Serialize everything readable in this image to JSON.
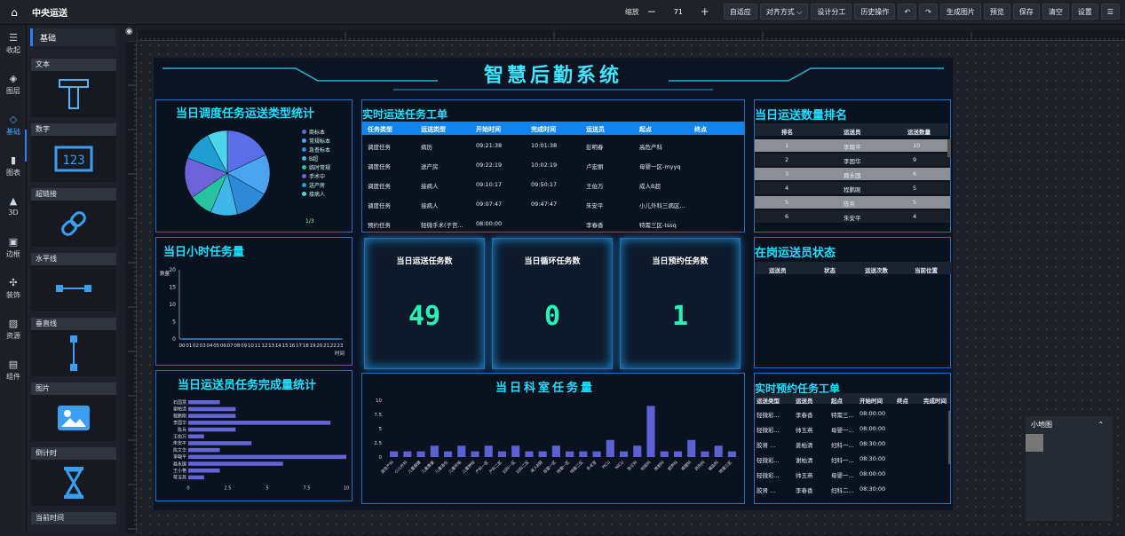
{
  "app": {
    "title": "中央运送"
  },
  "toolbar": {
    "zoom_label": "缩放",
    "zoom_minus": "−",
    "zoom_value": "71",
    "zoom_plus": "+",
    "buttons": [
      "自适应",
      "对齐方式 ⌵",
      "设计分工",
      "历史操作",
      "↶",
      "↷",
      "生成图片",
      "预览",
      "保存",
      "清空",
      "设置",
      "☰"
    ]
  },
  "nav": [
    {
      "icon": "☰",
      "label": "收起"
    },
    {
      "icon": "◈",
      "label": "图层"
    },
    {
      "icon": "◇",
      "label": "基础"
    },
    {
      "icon": "▮",
      "label": "图表"
    },
    {
      "icon": "▲",
      "label": "3D"
    },
    {
      "icon": "▣",
      "label": "边框"
    },
    {
      "icon": "✣",
      "label": "装饰"
    },
    {
      "icon": "▨",
      "label": "资源"
    },
    {
      "icon": "▤",
      "label": "组件"
    }
  ],
  "components": {
    "header": "基础",
    "items": [
      "文本",
      "数字",
      "超链接",
      "水平线",
      "垂直线",
      "图片",
      "倒计时",
      "当前时间"
    ]
  },
  "dashboard": {
    "title": "智慧后勤系统",
    "pie": {
      "title": "当日调度任务运送类型统计",
      "legend": [
        "商标本",
        "常规标本",
        "急查标本",
        "B超",
        "临时常规",
        "手术中",
        "送产房",
        "接病人"
      ],
      "pager": "1/3",
      "colors": [
        "#5b6ee8",
        "#4ba3f0",
        "#2c8ad8",
        "#3fb7e8",
        "#29c2a0",
        "#6d62d9",
        "#1f9ed1",
        "#4cd5ea"
      ],
      "chart_data": {
        "type": "pie",
        "values": [
          14,
          12,
          10,
          8,
          7,
          12,
          9,
          6
        ],
        "labels": [
          "商标本",
          "常规标本",
          "急查标本",
          "B超",
          "临时常规",
          "手术中",
          "送产房",
          "接病人"
        ]
      }
    },
    "orders": {
      "title": "实时运送任务工单",
      "headers": [
        "任务类型",
        "运送类型",
        "开始时间",
        "完成时间",
        "运送员",
        "起点",
        "终点"
      ],
      "rows": [
        [
          "调度任务",
          "病历",
          "09:21:38",
          "10:01:38",
          "彭明春",
          "高危产科",
          ""
        ],
        [
          "调度任务",
          "送产房",
          "09:22:19",
          "10:02:19",
          "卢宏丽",
          "母婴一区-myyq",
          ""
        ],
        [
          "调度任务",
          "接病人",
          "09:10:17",
          "09:50:17",
          "王伯万",
          "成人B超",
          ""
        ],
        [
          "调度任务",
          "接病人",
          "09:07:47",
          "09:47:47",
          "朱安平",
          "小儿外科三病区...",
          ""
        ],
        [
          "预约任务",
          "轻微手术(子宫...",
          "08:00:00",
          "",
          "李春香",
          "特需三区-tssq",
          ""
        ]
      ]
    },
    "ranking": {
      "title": "当日运送数量排名",
      "headers": [
        "排名",
        "运送员",
        "运送数量"
      ],
      "rows": [
        [
          "1",
          "李翰平",
          "10"
        ],
        [
          "2",
          "李国华",
          "9"
        ],
        [
          "3",
          "聂永国",
          "6"
        ],
        [
          "4",
          "程鹏刚",
          "5"
        ],
        [
          "5",
          "陈兵",
          "5"
        ],
        [
          "6",
          "朱安平",
          "4"
        ]
      ]
    },
    "hourly": {
      "title": "当日小时任务量",
      "chart_data": {
        "type": "line",
        "x": [
          "00",
          "01",
          "02",
          "03",
          "04",
          "05",
          "06",
          "07",
          "08",
          "09",
          "10",
          "11",
          "12",
          "13",
          "14",
          "15",
          "16",
          "17",
          "18",
          "19",
          "20",
          "21",
          "22",
          "23"
        ],
        "series": [
          {
            "values": [
              0,
              0,
              0,
              0,
              0,
              0,
              0,
              0,
              0,
              0,
              0,
              0,
              0,
              0,
              0,
              0,
              0,
              0,
              0,
              0,
              0,
              0,
              0,
              0
            ]
          }
        ],
        "ylim": [
          0,
          20
        ],
        "yticks": [
          0,
          5,
          10,
          15,
          20
        ],
        "ylabel": "数量",
        "xlabel": "时间"
      }
    },
    "stats": [
      {
        "label": "当日运送任务数",
        "value": "49"
      },
      {
        "label": "当日循环任务数",
        "value": "0"
      },
      {
        "label": "当日预约任务数",
        "value": "1"
      }
    ],
    "staffStatus": {
      "title": "在岗运送员状态",
      "headers": [
        "运送员",
        "状态",
        "运送次数",
        "当前位置"
      ]
    },
    "staffChart": {
      "title": "当日运送员任务完成量统计",
      "chart_data": {
        "type": "bar",
        "categories": [
          "石国慧",
          "谢柏清",
          "程鹏刚",
          "李国华",
          "陈兵",
          "王伯万",
          "朱安平",
          "陈文华",
          "李翰平",
          "聂永国",
          "王小艳",
          "蒋玉燕"
        ],
        "values": [
          2,
          3,
          3,
          9,
          3,
          1,
          4,
          2,
          10,
          6,
          2,
          1
        ],
        "xlim": [
          0,
          10
        ],
        "xticks": [
          "0",
          "2.5",
          "5",
          "7.5",
          "10"
        ]
      }
    },
    "deptChart": {
      "title": "当日科室任务量",
      "chart_data": {
        "type": "bar",
        "categories": [
          "高危产科",
          "小儿外科",
          "儿童保健",
          "儿童康复",
          "儿童消化",
          "儿童呼吸",
          "儿童神经",
          "产科一区",
          "产科二区",
          "妇科一区",
          "妇科二区",
          "成人B超",
          "母婴一区",
          "特需一区",
          "特需二区",
          "手术室",
          "PICU",
          "NICU",
          "急诊科",
          "检验科",
          "放射科",
          "超声科",
          "病理科",
          "药剂科",
          "输血科",
          "特需三区"
        ],
        "values": [
          1,
          1,
          1,
          2,
          1,
          2,
          1,
          2,
          1,
          2,
          1,
          1,
          2,
          1,
          1,
          1,
          3,
          1,
          2,
          9,
          1,
          1,
          3,
          1,
          2,
          1
        ],
        "ylim": [
          0,
          10
        ],
        "yticks": [
          "0",
          "2.5",
          "5",
          "7.5",
          "10"
        ]
      }
    },
    "reservations": {
      "title": "实时预约任务工单",
      "headers": [
        "运送类型",
        "运送员",
        "起点",
        "开始时间",
        "终点",
        "完成时间"
      ],
      "rows": [
        [
          "轻微彩...",
          "李春香",
          "特需三...",
          "08:00:00"
        ],
        [
          "轻微彩...",
          "帅玉燕",
          "母婴一...",
          "08:00:00"
        ],
        [
          "胶肾 ...",
          "姜柏清",
          "妇科一...",
          "08:30:00"
        ],
        [
          "轻微彩...",
          "谢柏清",
          "妇科一...",
          "08:30:00"
        ],
        [
          "轻微彩...",
          "帅玉燕",
          "母婴一...",
          "08:00:00"
        ],
        [
          "胶肾 ...",
          "李春香",
          "妇科二...",
          "08:30:00"
        ]
      ]
    }
  },
  "minimap": {
    "title": "小地图",
    "chevron": "⌃"
  }
}
